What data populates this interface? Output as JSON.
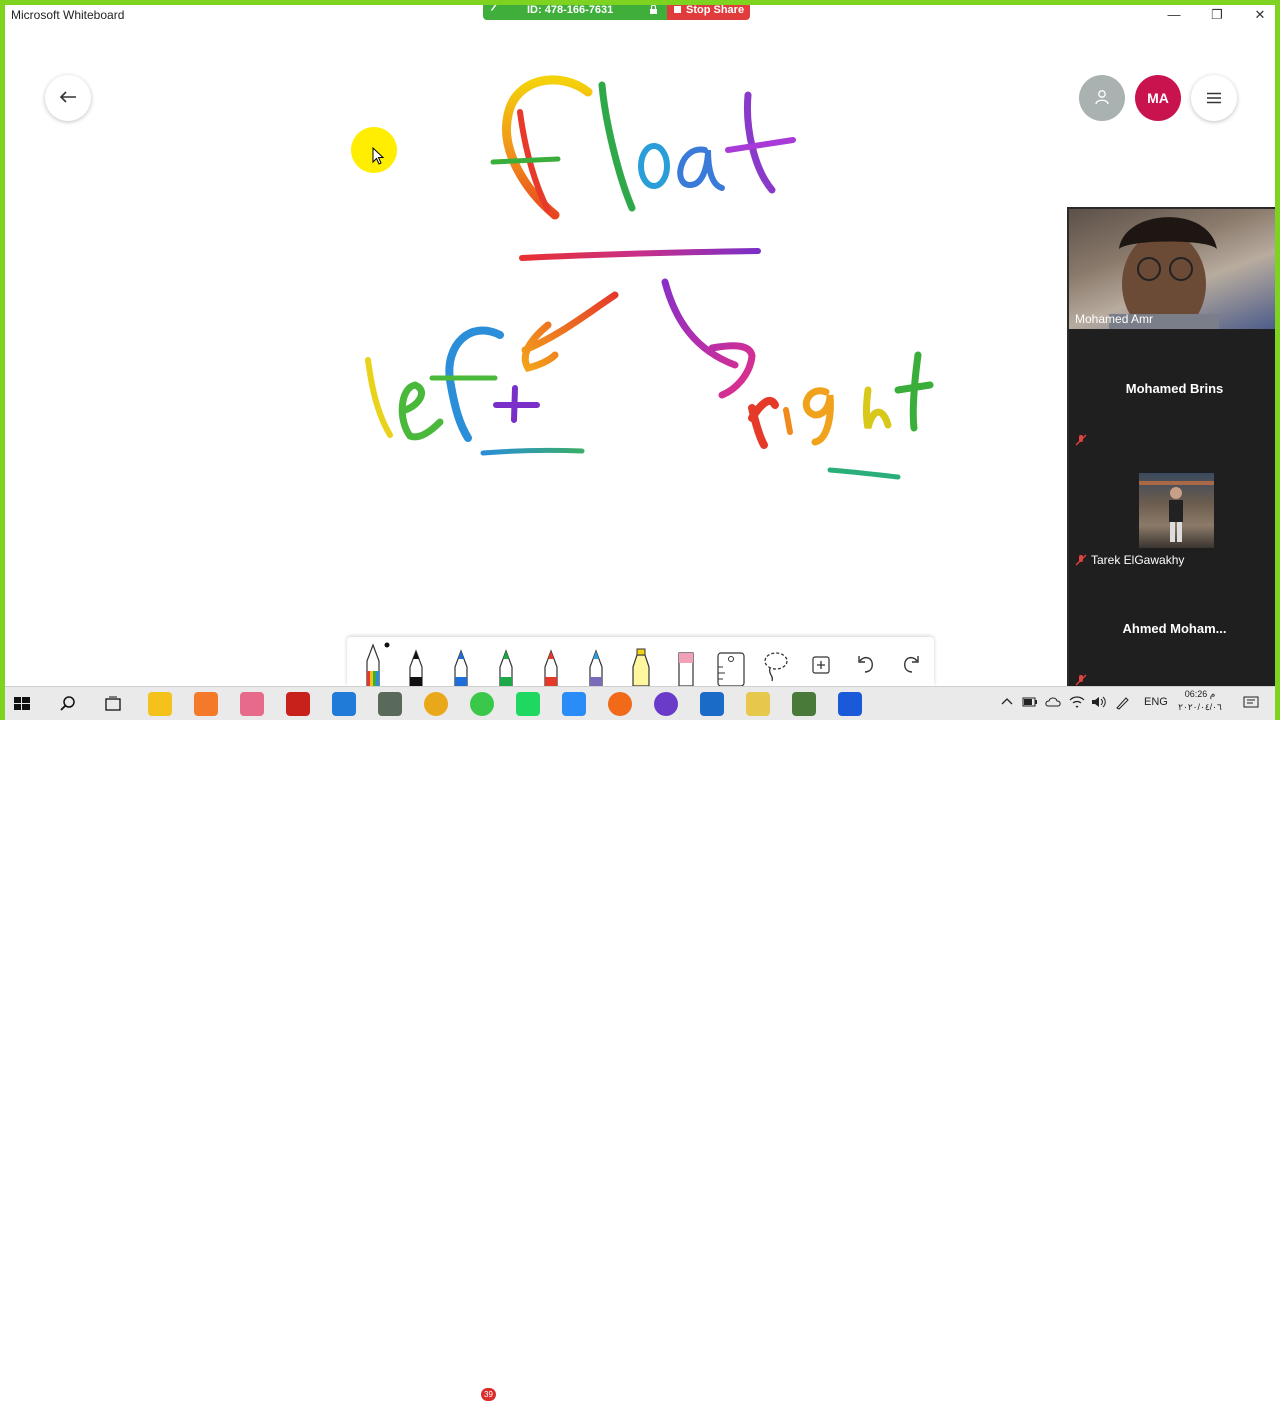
{
  "window": {
    "title": "Microsoft Whiteboard",
    "minimize_glyph": "—",
    "restore_glyph": "❐",
    "close_glyph": "✕"
  },
  "share_bar": {
    "meeting_id": "ID: 478-166-7631",
    "stop_label": "Stop Share",
    "lock_icon": "lock-icon",
    "pen_icon": "pen-icon"
  },
  "whiteboard": {
    "back_icon": "back-arrow-icon",
    "participant_icon": "person-icon",
    "user_initials": "MA",
    "user_color": "#c8134f",
    "menu_icon": "hamburger-menu-icon",
    "handwriting_words": [
      "Float",
      "left",
      "right"
    ]
  },
  "participants": [
    {
      "name": "Mohamed Amr",
      "video": true
    },
    {
      "name": "Mohamed Brins",
      "muted": true
    },
    {
      "name": "Tarek ElGawakhy",
      "muted": true,
      "thumbnail": true
    },
    {
      "name": "Ahmed  Moham...",
      "muted": true
    }
  ],
  "toolbar": {
    "tools": [
      "rainbow-pen",
      "black-pen",
      "blue-pen",
      "green-pen",
      "red-pen",
      "galaxy-pen",
      "highlighter",
      "eraser",
      "ruler",
      "lasso",
      "add-content",
      "undo",
      "redo"
    ]
  },
  "taskbar": {
    "apps": [
      "start",
      "search",
      "task-view",
      "file-explorer",
      "xampp",
      "snipping-tool",
      "filezilla",
      "vscode",
      "app-9",
      "chrome",
      "whatsapp",
      "spotify",
      "zoom",
      "firefox",
      "app-15",
      "trello",
      "app-17",
      "app-18",
      "whiteboard"
    ],
    "whatsapp_badge": "39",
    "language": "ENG",
    "time": "06:26 م",
    "date": "٢٠٢٠/٠٤/٠٦"
  },
  "colors": {
    "frame_green": "#7ed321",
    "share_green": "#3fae3a",
    "stop_red": "#e03c3c",
    "panel_dark": "#1f1f1f"
  }
}
